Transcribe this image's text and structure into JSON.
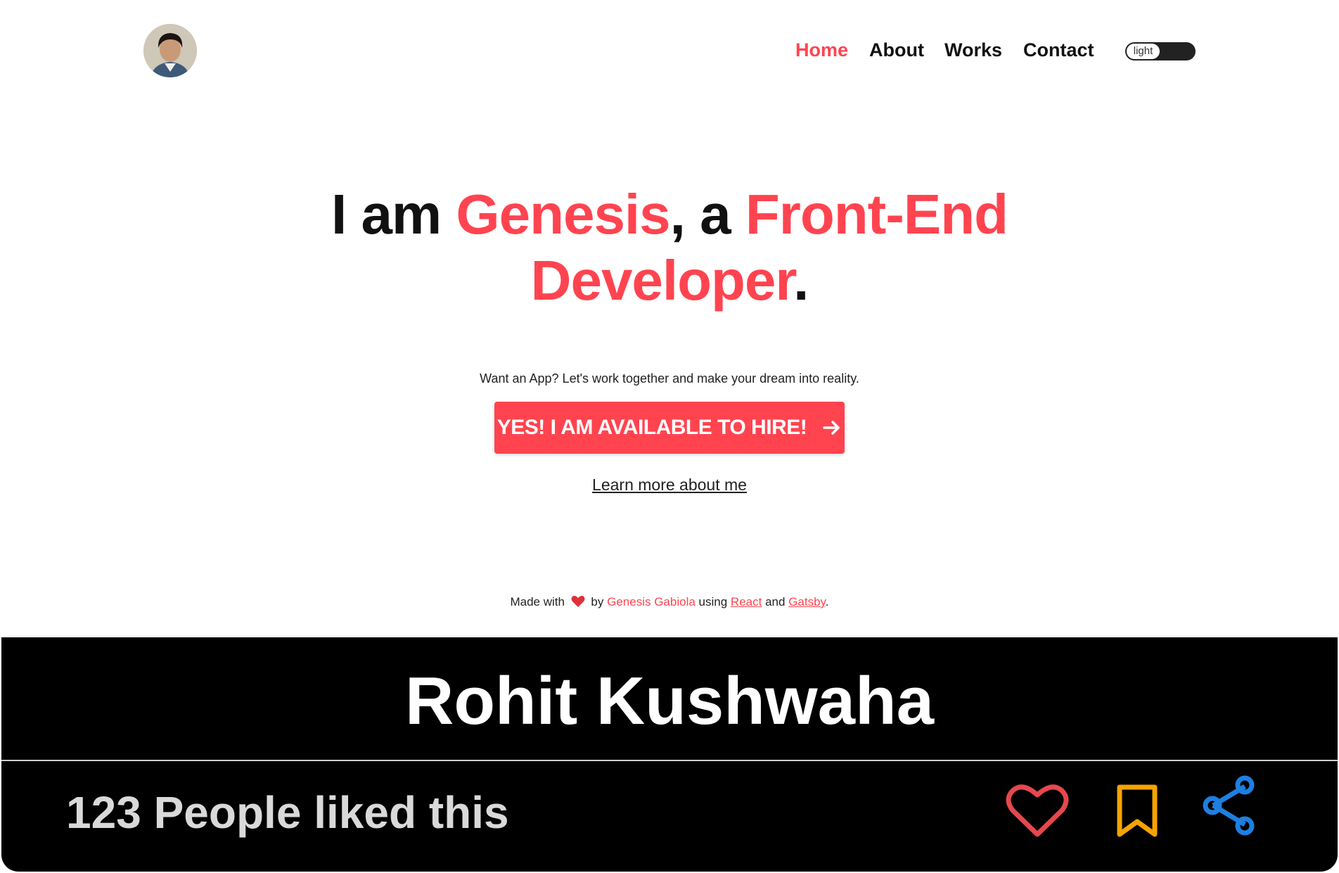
{
  "nav": {
    "links": [
      "Home",
      "About",
      "Works",
      "Contact"
    ],
    "active": "Home",
    "theme_toggle_label": "light"
  },
  "hero": {
    "part1": "I am ",
    "name": "Genesis",
    "part2": ", a ",
    "role_line1": "Front-End",
    "role_line2": "Developer",
    "period": "."
  },
  "tagline": "Want an App? Let's work together and make your dream into reality.",
  "cta_label": "YES! I AM AVAILABLE TO HIRE!",
  "learn_more": "Learn more about me",
  "footer": {
    "made_with": "Made with",
    "by": "by",
    "author": "Genesis Gabiola",
    "using": "using",
    "react": "React",
    "and": "and",
    "gatsby": "Gatsby",
    "end": "."
  },
  "card": {
    "title": "Rohit Kushwaha",
    "likes_text": "123 People liked this"
  },
  "colors": {
    "accent": "#ff4450",
    "like_icon": "#e5484d",
    "bookmark_icon": "#f5a300",
    "share_icon": "#1e7fe0"
  }
}
